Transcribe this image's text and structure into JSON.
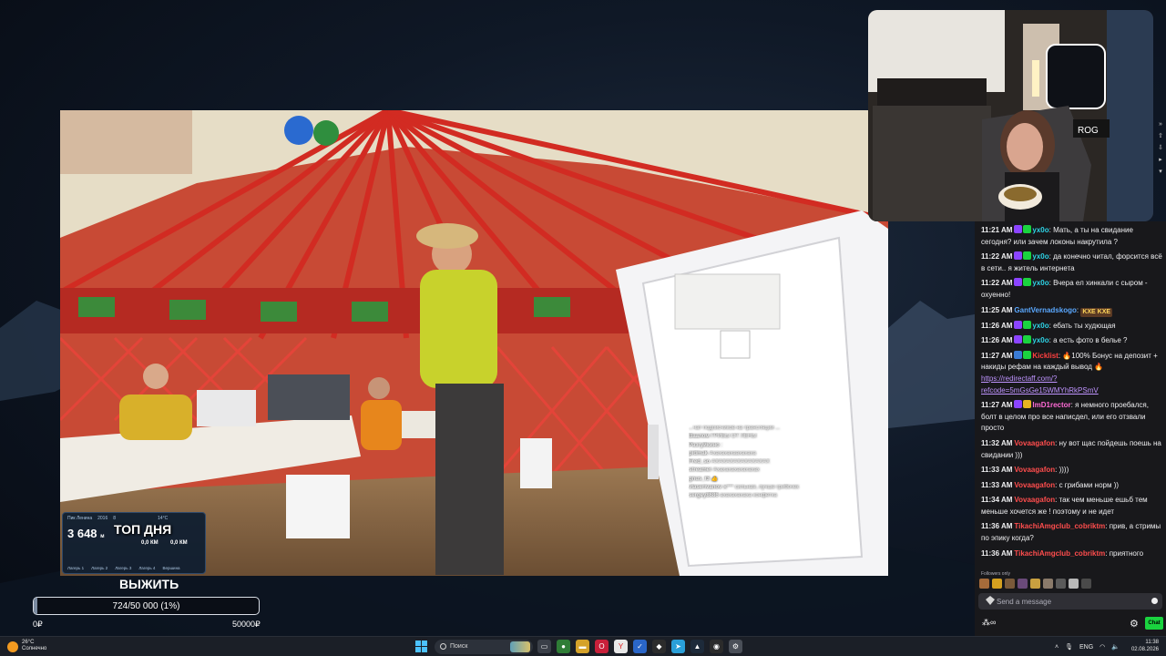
{
  "video_overlay": {
    "top_day_banner": "ТОП ДНЯ",
    "widget_header": [
      "Пик Ленина",
      "2016",
      "8"
    ],
    "widget_temp": "14°C",
    "widget_value": "3 648",
    "widget_unit": "м",
    "widget_kmh": "0,0 КМ",
    "widget_km": "0,0 КМ",
    "widget_bottom": [
      "Лагерь 1",
      "Лагерь 2",
      "Лагерь 3",
      "Лагерь 4",
      "Вершина"
    ],
    "chat_lines": [
      {
        "user": "",
        "text": "...чат подписчиков на трансляции ..."
      },
      {
        "user": "Ваалом",
        "text": "ГРИБЫ ОТ ЛЕНЫ"
      },
      {
        "user": "Разгуйкино",
        "text": ":"
      },
      {
        "user": "pidmak",
        "text": "Ахахахахаахахаха"
      },
      {
        "user": "Fred_so",
        "text": "АХАХАХАХАХАХАХАХ"
      },
      {
        "user": "streamer",
        "text": "Ахахахахахахахах"
      },
      {
        "user": "gnus_f3",
        "text": "👍"
      },
      {
        "user": "vlaserivanov",
        "text": "ж*** сильная, лучше грибочек"
      },
      {
        "user": "sergey8686",
        "text": "ахахахахаха конфетка"
      }
    ]
  },
  "goal": {
    "title": "ВЫЖИТЬ",
    "progress_text": "724/50 000 (1%)",
    "progress_fraction": 0.0145,
    "min_label": "0₽",
    "max_label": "50000₽"
  },
  "webcam_side": {
    "arrows": [
      "»",
      "⇧",
      "⇩",
      "▸",
      "▾"
    ]
  },
  "chat": {
    "messages": [
      {
        "time": "11:21 AM",
        "user": "yx0o",
        "color": "#2ed3e6",
        "badges": [
          "#8b44ff",
          "#1ad33f"
        ],
        "text": ": Мать, а ты на свидание сегодня? или зачем локоны накрутила ?"
      },
      {
        "time": "11:22 AM",
        "user": "yx0o",
        "color": "#2ed3e6",
        "badges": [
          "#8b44ff",
          "#1ad33f"
        ],
        "text": ": да конечно читал, форсится всё в сети.. я житель интернета"
      },
      {
        "time": "11:22 AM",
        "user": "yx0o",
        "color": "#2ed3e6",
        "badges": [
          "#8b44ff",
          "#1ad33f"
        ],
        "text": ": Вчера ел хинкали с сыром - охуенно!"
      },
      {
        "time": "11:25 AM",
        "user": "GantVernadskogo",
        "color": "#5aa8ff",
        "badges": [],
        "text": ":",
        "emotes": [
          "KXE KXE"
        ]
      },
      {
        "time": "11:26 AM",
        "user": "yx0o",
        "color": "#2ed3e6",
        "badges": [
          "#8b44ff",
          "#1ad33f"
        ],
        "text": ": ебать ты худющая"
      },
      {
        "time": "11:26 AM",
        "user": "yx0o",
        "color": "#2ed3e6",
        "badges": [
          "#8b44ff",
          "#1ad33f"
        ],
        "text": ": а есть фото в белье ?"
      },
      {
        "time": "11:27 AM",
        "user": "Kicklist",
        "color": "#ff4040",
        "badges": [
          "#3a7bd5",
          "#1ad33f"
        ],
        "text": ": 🔥100% Бонус на депозит + накиды рефам на каждый вывод 🔥",
        "link": "https://redirectaff.com/?refcode=5mGsGe15WMYhRkPSmV"
      },
      {
        "time": "11:27 AM",
        "user": "ImD1rector",
        "color": "#ff6ad5",
        "badges": [
          "#8b44ff",
          "#e6b422"
        ],
        "text": ": я немного проебался, болт в целом про все написдел, или его отзвали просто"
      },
      {
        "time": "11:32 AM",
        "user": "Vovaagafon",
        "color": "#ff4d4d",
        "badges": [],
        "text": ": ну вот щас пойдешь поешь на свидании )))"
      },
      {
        "time": "11:33 AM",
        "user": "Vovaagafon",
        "color": "#ff4d4d",
        "badges": [],
        "text": ": ))))"
      },
      {
        "time": "11:33 AM",
        "user": "Vovaagafon",
        "color": "#ff4d4d",
        "badges": [],
        "text": ": с грибами норм ))"
      },
      {
        "time": "11:34 AM",
        "user": "Vovaagafon",
        "color": "#ff4d4d",
        "badges": [],
        "text": ": так чем меньше ешьб тем меньше хочется же ! поэтому и не идет"
      },
      {
        "time": "11:36 AM",
        "user": "TikachiAmgclub_cobriktm",
        "color": "#ff4d4d",
        "badges": [],
        "text": ": прив, а стримы по эпику когда?"
      },
      {
        "time": "11:36 AM",
        "user": "TikachiAmgclub_cobriktm",
        "color": "#ff4d4d",
        "badges": [],
        "text": ": приятного"
      }
    ],
    "followers_only": "Followers only",
    "send_placeholder": "Send a message",
    "points_label": "∞",
    "chat_button": "Chat"
  },
  "taskbar": {
    "weather_temp": "26°C",
    "weather_desc": "Солнечно",
    "search_placeholder": "Поиск",
    "lang": "ENG",
    "time": "11:38",
    "date": "02.08.2026"
  }
}
